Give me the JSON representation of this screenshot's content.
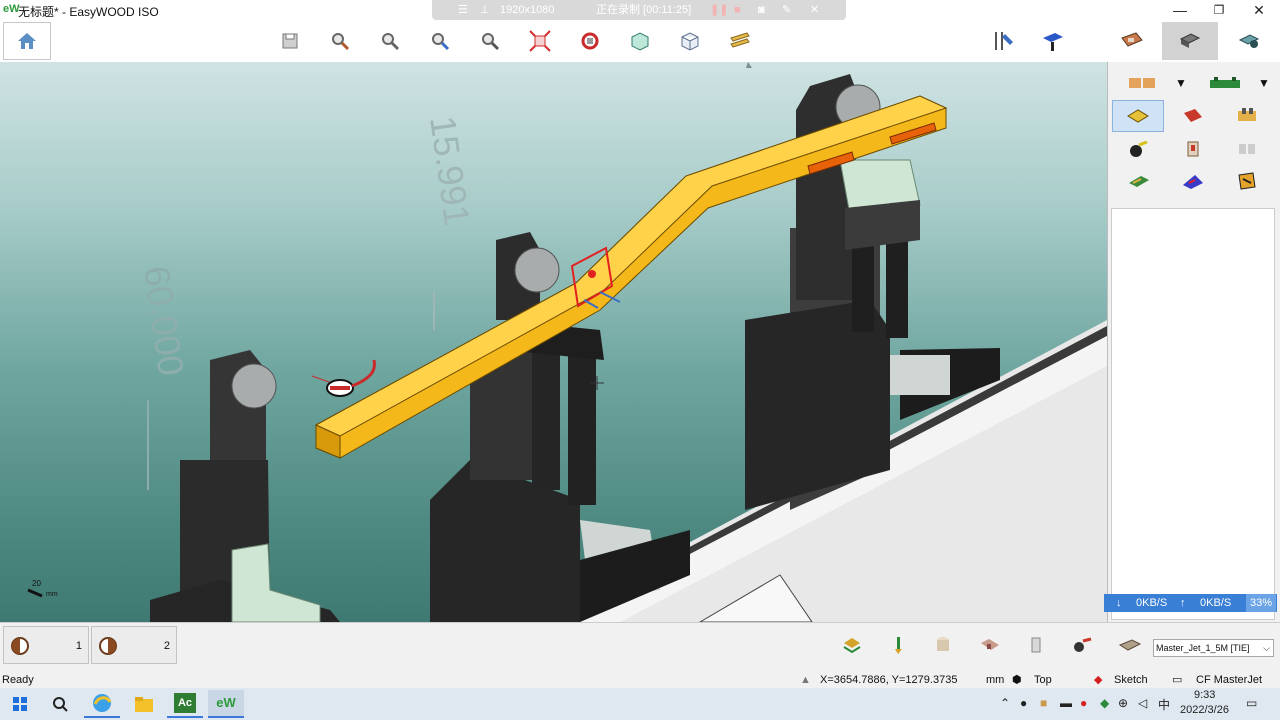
{
  "app": {
    "logo": "eW",
    "title": "无标题* - EasyWOOD ISO",
    "window_controls": [
      "—",
      "❐",
      "✕"
    ]
  },
  "recorder": {
    "resolution": "1920x1080",
    "status": "正在录制 [00:11:25]"
  },
  "toolbar": {
    "tools": [
      "save-icon",
      "zoom-in-icon",
      "zoom-out-icon",
      "zoom-window-icon",
      "zoom-previous-icon",
      "fit-view-icon",
      "rotate-view-icon",
      "solid-view-icon",
      "wireframe-view-icon",
      "section-icon"
    ],
    "right_tools": [
      "tools-icon",
      "machine-icon",
      "library-icon",
      "setup-icon",
      "simulate-icon"
    ]
  },
  "viewport": {
    "dimension_labels": [
      "15.991",
      "60.000"
    ],
    "scale_label": "20",
    "scale_unit": "mm"
  },
  "palette": {
    "net_down": "0KB/S",
    "net_up": "0KB/S",
    "net_percent": "33%"
  },
  "bottombar": {
    "views": [
      {
        "num": "1"
      },
      {
        "num": "2"
      }
    ],
    "machine_select": "Master_Jet_1_5M [TIE]"
  },
  "statusbar": {
    "ready": "Ready",
    "coords": "X=3654.7886, Y=1279.3735",
    "unit": "mm",
    "view": "Top",
    "mode": "Sketch",
    "machine": "CF MasterJet"
  },
  "taskbar": {
    "apps": [
      "windows-start-icon",
      "search-icon",
      "browser-icon",
      "file-explorer-icon",
      "autocad-icon",
      "easywood-icon"
    ],
    "app_labels": {
      "autocad": "Ac",
      "easywood": "eW"
    },
    "ime": "中",
    "time": "9:33",
    "date": "2022/3/26"
  },
  "colors": {
    "beam": "#f5b81a",
    "clamp": "#3b3b3b",
    "accent": "#3a7fd6"
  }
}
